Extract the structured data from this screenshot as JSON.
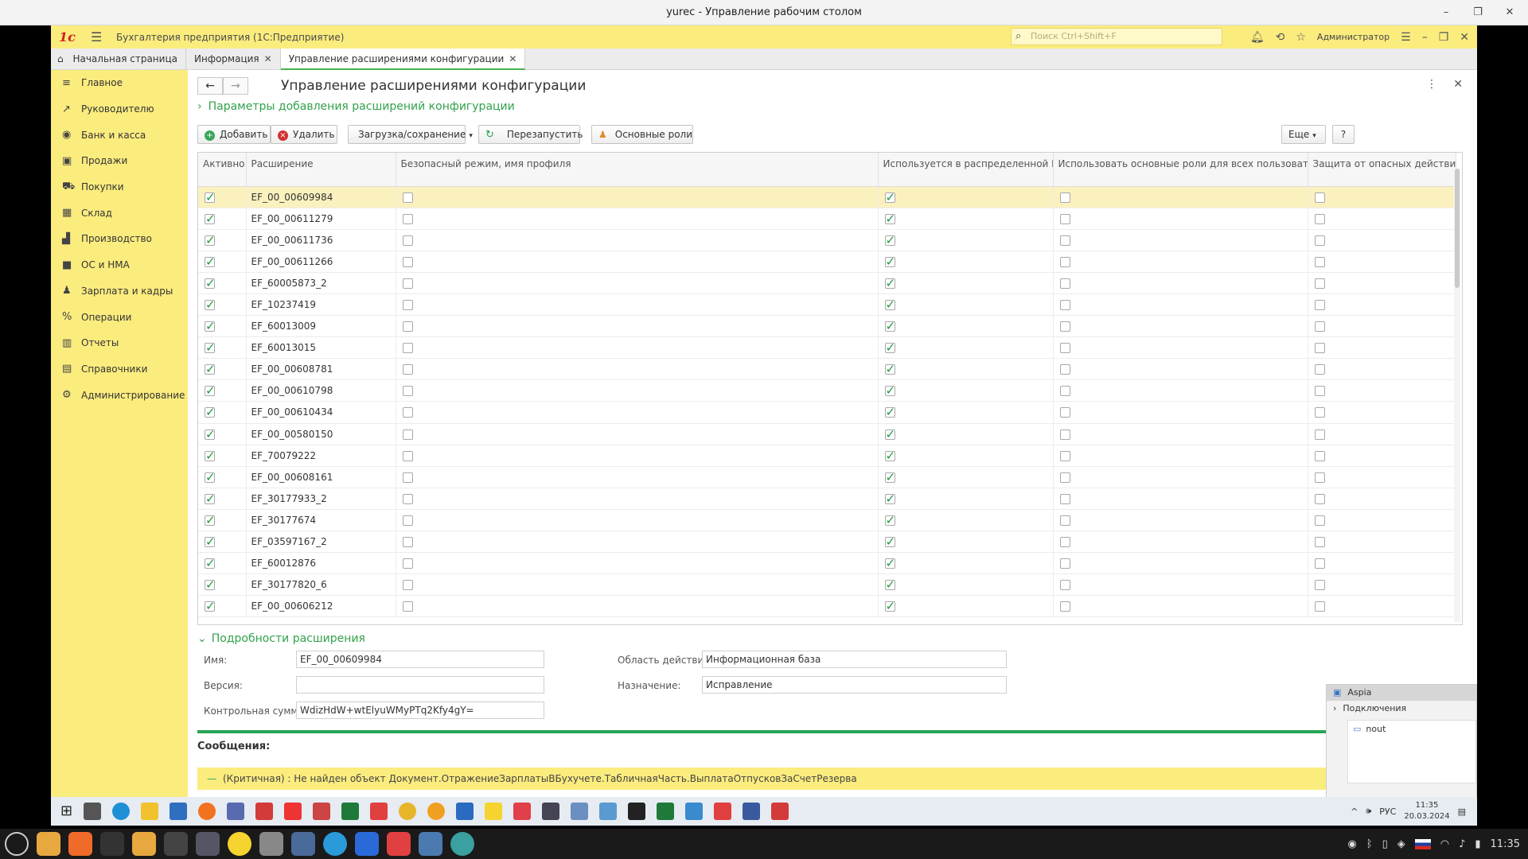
{
  "outer_window": {
    "title": "yurec - Управление рабочим столом",
    "controls": [
      "–",
      "❐",
      "✕"
    ]
  },
  "topbar": {
    "logo": "1с",
    "app_title": "Бухгалтерия предприятия  (1С:Предприятие)",
    "search_placeholder": "Поиск Ctrl+Shift+F",
    "user": "Администратор"
  },
  "tabs": [
    {
      "label": "Начальная страница"
    },
    {
      "label": "Информация"
    },
    {
      "label": "Управление расширениями конфигурации"
    }
  ],
  "sidebar": {
    "items": [
      {
        "label": "Главное",
        "icon": "menu-icon"
      },
      {
        "label": "Руководителю",
        "icon": "chart-icon"
      },
      {
        "label": "Банк и касса",
        "icon": "bank-icon"
      },
      {
        "label": "Продажи",
        "icon": "bag-icon"
      },
      {
        "label": "Покупки",
        "icon": "cart-icon"
      },
      {
        "label": "Склад",
        "icon": "warehouse-icon"
      },
      {
        "label": "Производство",
        "icon": "factory-icon"
      },
      {
        "label": "ОС и НМА",
        "icon": "truck-icon"
      },
      {
        "label": "Зарплата и кадры",
        "icon": "person-icon"
      },
      {
        "label": "Операции",
        "icon": "operations-icon"
      },
      {
        "label": "Отчеты",
        "icon": "report-icon"
      },
      {
        "label": "Справочники",
        "icon": "book-icon"
      },
      {
        "label": "Администрирование",
        "icon": "gear-icon"
      }
    ]
  },
  "page": {
    "title": "Управление расширениями конфигурации",
    "params_link": "Параметры добавления расширений конфигурации"
  },
  "commands": {
    "add": "Добавить",
    "delete": "Удалить",
    "load_save": "Загрузка/сохранение",
    "restart": "Перезапустить",
    "main_roles": "Основные роли",
    "more": "Еще",
    "help": "?"
  },
  "table": {
    "headers": [
      "Активно",
      "Расширение",
      "Безопасный режим, имя профиля",
      "Используется в распределенной ИБ",
      "Использовать основные роли для всех пользователей",
      "Защита от опасных действий"
    ],
    "rows": [
      {
        "name": "EF_00_00609984",
        "active": true,
        "safe": false,
        "distributed": true,
        "roles": false,
        "protect": false
      },
      {
        "name": "EF_00_00611279",
        "active": true,
        "safe": false,
        "distributed": true,
        "roles": false,
        "protect": false
      },
      {
        "name": "EF_00_00611736",
        "active": true,
        "safe": false,
        "distributed": true,
        "roles": false,
        "protect": false
      },
      {
        "name": "EF_00_00611266",
        "active": true,
        "safe": false,
        "distributed": true,
        "roles": false,
        "protect": false
      },
      {
        "name": "EF_60005873_2",
        "active": true,
        "safe": false,
        "distributed": true,
        "roles": false,
        "protect": false
      },
      {
        "name": "EF_10237419",
        "active": true,
        "safe": false,
        "distributed": true,
        "roles": false,
        "protect": false
      },
      {
        "name": "EF_60013009",
        "active": true,
        "safe": false,
        "distributed": true,
        "roles": false,
        "protect": false
      },
      {
        "name": "EF_60013015",
        "active": true,
        "safe": false,
        "distributed": true,
        "roles": false,
        "protect": false
      },
      {
        "name": "EF_00_00608781",
        "active": true,
        "safe": false,
        "distributed": true,
        "roles": false,
        "protect": false
      },
      {
        "name": "EF_00_00610798",
        "active": true,
        "safe": false,
        "distributed": true,
        "roles": false,
        "protect": false
      },
      {
        "name": "EF_00_00610434",
        "active": true,
        "safe": false,
        "distributed": true,
        "roles": false,
        "protect": false
      },
      {
        "name": "EF_00_00580150",
        "active": true,
        "safe": false,
        "distributed": true,
        "roles": false,
        "protect": false
      },
      {
        "name": "EF_70079222",
        "active": true,
        "safe": false,
        "distributed": true,
        "roles": false,
        "protect": false
      },
      {
        "name": "EF_00_00608161",
        "active": true,
        "safe": false,
        "distributed": true,
        "roles": false,
        "protect": false
      },
      {
        "name": "EF_30177933_2",
        "active": true,
        "safe": false,
        "distributed": true,
        "roles": false,
        "protect": false
      },
      {
        "name": "EF_30177674",
        "active": true,
        "safe": false,
        "distributed": true,
        "roles": false,
        "protect": false
      },
      {
        "name": "EF_03597167_2",
        "active": true,
        "safe": false,
        "distributed": true,
        "roles": false,
        "protect": false
      },
      {
        "name": "EF_60012876",
        "active": true,
        "safe": false,
        "distributed": true,
        "roles": false,
        "protect": false
      },
      {
        "name": "EF_30177820_6",
        "active": true,
        "safe": false,
        "distributed": true,
        "roles": false,
        "protect": false
      },
      {
        "name": "EF_00_00606212",
        "active": true,
        "safe": false,
        "distributed": true,
        "roles": false,
        "protect": false
      }
    ]
  },
  "details": {
    "title": "Подробности расширения",
    "name_label": "Имя:",
    "name_value": "EF_00_00609984",
    "version_label": "Версия:",
    "version_value": "",
    "checksum_label": "Контрольная сумма:",
    "checksum_value": "WdizHdW+wtElyuWMyPTq2Kfy4gY=",
    "scope_label": "Область действия:",
    "scope_value": "Информационная база",
    "purpose_label": "Назначение:",
    "purpose_value": "Исправление"
  },
  "messages": {
    "title": "Сообщения:",
    "text": "(Критичная) : Не найден объект Документ.ОтражениеЗарплатыВБухучете.ТабличнаяЧасть.ВыплатаОтпусковЗаСчетРезерва"
  },
  "popup": {
    "row1": "Aspia",
    "row2": "Подключения",
    "item": "nout"
  },
  "win_taskbar": {
    "lang": "РУС",
    "time": "11:35",
    "date": "20.03.2024"
  },
  "linux_panel": {
    "time": "11:35"
  },
  "colors": {
    "accent_yellow": "#fbec7e",
    "link_green": "#31a24c",
    "selected_row": "#fbf1bf"
  }
}
